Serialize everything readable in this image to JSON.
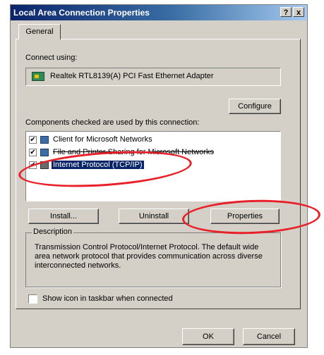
{
  "window": {
    "title": "Local Area Connection Properties",
    "help_label": "?",
    "close_label": "x"
  },
  "tabs": [
    {
      "label": "General"
    }
  ],
  "connect_using": {
    "label": "Connect using:",
    "adapter": "Realtek RTL8139(A) PCI Fast Ethernet Adapter",
    "configure_label": "Configure"
  },
  "components": {
    "label": "Components checked are used by this connection:",
    "items": [
      {
        "label": "Client for Microsoft Networks",
        "checked": true,
        "check_glyph": "✔"
      },
      {
        "label": "File and Printer Sharing for Microsoft Networks",
        "checked": true,
        "check_glyph": "✔"
      },
      {
        "label": "Internet Protocol (TCP/IP)",
        "checked": true,
        "selected": true,
        "check_glyph": "✔"
      }
    ],
    "install_label": "Install...",
    "uninstall_label": "Uninstall",
    "properties_label": "Properties"
  },
  "description": {
    "label": "Description",
    "text": "Transmission Control Protocol/Internet Protocol. The default wide area network protocol that provides communication across diverse interconnected networks."
  },
  "show_icon": {
    "label": "Show icon in taskbar when connected",
    "checked": false
  },
  "footer": {
    "ok_label": "OK",
    "cancel_label": "Cancel"
  },
  "annotation_color": "#e8202a"
}
